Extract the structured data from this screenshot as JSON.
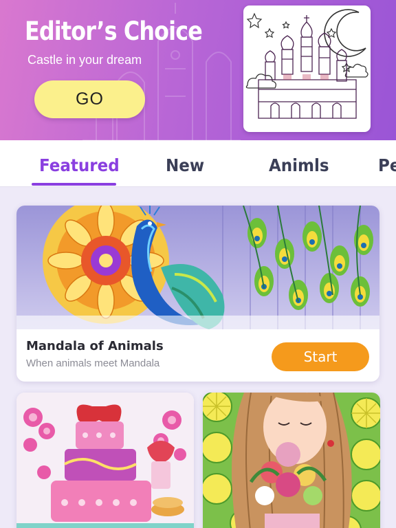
{
  "banner": {
    "title": "Editor’s Choice",
    "subtitle": "Castle in your dream",
    "go_label": "GO"
  },
  "tabs": [
    {
      "label": "Featured",
      "active": true
    },
    {
      "label": "New",
      "active": false
    },
    {
      "label": "Animls",
      "active": false
    },
    {
      "label": "Pe",
      "active": false
    }
  ],
  "featured": {
    "title": "Mandala of Animals",
    "subtitle": "When animals meet Mandala",
    "start_label": "Start"
  },
  "grid": [
    {
      "name": "cake-coloring-page"
    },
    {
      "name": "girl-with-flowers-coloring-page"
    }
  ],
  "colors": {
    "accent": "#8a3fe0",
    "start": "#f59a1c",
    "go": "#fbf08c"
  }
}
